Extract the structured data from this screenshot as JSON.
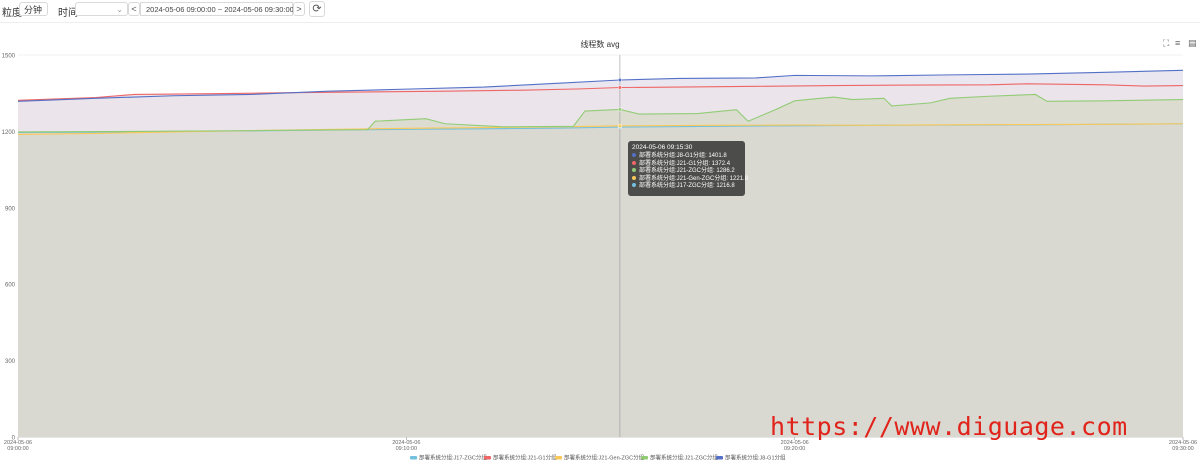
{
  "toolbar": {
    "granularity_label": "粒度:",
    "granularity_value": "分钟",
    "time_label": "时间:",
    "time_select_value": "",
    "prev_label": "<",
    "range_value": "2024-05-06 09:00:00  ~  2024-05-06 09:30:00",
    "next_label": ">",
    "refresh_icon": "refresh-icon"
  },
  "watermark": "https://www.diguage.com",
  "tooltip": {
    "time": "2024-05-06 09:15:30",
    "rows": [
      {
        "color": "#5470c6",
        "text": "部署系统分组:J8-G1分组: 1401.8"
      },
      {
        "color": "#ee6666",
        "text": "部署系统分组:J21-G1分组: 1372.4"
      },
      {
        "color": "#91cc75",
        "text": "部署系统分组:J21-ZGC分组: 1286.2"
      },
      {
        "color": "#fac858",
        "text": "部署系统分组:J21-Gen-ZGC分组: 1221.8"
      },
      {
        "color": "#73c0de",
        "text": "部署系统分组:J17-ZGC分组: 1216.8"
      }
    ]
  },
  "chart_data": {
    "type": "area",
    "title": "线程数 avg",
    "ylim": [
      0,
      1500
    ],
    "y_ticks": [
      0,
      300,
      600,
      900,
      1200,
      1500
    ],
    "x_ticks": [
      {
        "date": "2024-05-06",
        "time": "09:00:00"
      },
      {
        "date": "2024-05-06",
        "time": "09:10:00"
      },
      {
        "date": "2024-05-06",
        "time": "09:20:00"
      },
      {
        "date": "2024-05-06",
        "time": "09:30:00"
      }
    ],
    "x_range_minutes": [
      0,
      30
    ],
    "crosshair_minute": 15.5,
    "grid": "horizontal",
    "legend_position": "bottom-center",
    "series": [
      {
        "name": "部署系统分组:J17-ZGC分组",
        "color": "#73c0de",
        "points": [
          [
            0,
            1196
          ],
          [
            2,
            1197
          ],
          [
            4,
            1200
          ],
          [
            6,
            1202
          ],
          [
            8,
            1205
          ],
          [
            10,
            1208
          ],
          [
            12,
            1210
          ],
          [
            14,
            1213
          ],
          [
            15.5,
            1216.8
          ],
          [
            18,
            1220
          ],
          [
            20,
            1222
          ],
          [
            22,
            1224
          ],
          [
            24,
            1225
          ],
          [
            26,
            1226
          ],
          [
            28,
            1228
          ],
          [
            30,
            1230
          ]
        ]
      },
      {
        "name": "部署系统分组:J21-G1分组",
        "color": "#ee6666",
        "points": [
          [
            0,
            1322
          ],
          [
            2,
            1333
          ],
          [
            3,
            1345
          ],
          [
            5,
            1348
          ],
          [
            7,
            1352
          ],
          [
            9,
            1355
          ],
          [
            11,
            1358
          ],
          [
            13,
            1362
          ],
          [
            14.5,
            1367
          ],
          [
            15.5,
            1372.4
          ],
          [
            17,
            1374
          ],
          [
            19,
            1377
          ],
          [
            21,
            1380
          ],
          [
            23,
            1382
          ],
          [
            25,
            1383
          ],
          [
            26,
            1387
          ],
          [
            28,
            1383
          ],
          [
            29,
            1378
          ],
          [
            30,
            1380
          ]
        ]
      },
      {
        "name": "部署系统分组:J21-Gen-ZGC分组",
        "color": "#fac858",
        "points": [
          [
            0,
            1188
          ],
          [
            2,
            1192
          ],
          [
            4,
            1198
          ],
          [
            6,
            1203
          ],
          [
            8,
            1208
          ],
          [
            10,
            1212
          ],
          [
            12,
            1215
          ],
          [
            14,
            1218
          ],
          [
            15.5,
            1221.8
          ],
          [
            18,
            1224
          ],
          [
            20,
            1225
          ],
          [
            22,
            1224
          ],
          [
            24,
            1226
          ],
          [
            26,
            1227
          ],
          [
            28,
            1228
          ],
          [
            30,
            1230
          ]
        ]
      },
      {
        "name": "部署系统分组:J21-ZGC分组",
        "color": "#91cc75",
        "points": [
          [
            0,
            1198
          ],
          [
            3,
            1200
          ],
          [
            6,
            1203
          ],
          [
            9,
            1207
          ],
          [
            9.2,
            1240
          ],
          [
            10.5,
            1250
          ],
          [
            11,
            1230
          ],
          [
            12.5,
            1218
          ],
          [
            14.3,
            1220
          ],
          [
            14.6,
            1280
          ],
          [
            15.5,
            1286.2
          ],
          [
            16,
            1268
          ],
          [
            17.5,
            1270
          ],
          [
            18.5,
            1285
          ],
          [
            18.8,
            1240
          ],
          [
            19.5,
            1285
          ],
          [
            20,
            1320
          ],
          [
            21,
            1335
          ],
          [
            21.5,
            1325
          ],
          [
            22.3,
            1330
          ],
          [
            22.5,
            1300
          ],
          [
            23.5,
            1312
          ],
          [
            24,
            1330
          ],
          [
            25,
            1338
          ],
          [
            26.2,
            1345
          ],
          [
            26.5,
            1318
          ],
          [
            28,
            1320
          ],
          [
            30,
            1325
          ]
        ]
      },
      {
        "name": "部署系统分组:J8-G1分组",
        "color": "#5470c6",
        "points": [
          [
            0,
            1318
          ],
          [
            2,
            1330
          ],
          [
            4,
            1340
          ],
          [
            6,
            1345
          ],
          [
            8,
            1358
          ],
          [
            10,
            1366
          ],
          [
            12,
            1374
          ],
          [
            14,
            1390
          ],
          [
            15.5,
            1401.8
          ],
          [
            17,
            1408
          ],
          [
            19,
            1410
          ],
          [
            20,
            1420
          ],
          [
            22,
            1418
          ],
          [
            24,
            1422
          ],
          [
            26,
            1425
          ],
          [
            28,
            1432
          ],
          [
            30,
            1440
          ]
        ]
      }
    ]
  }
}
